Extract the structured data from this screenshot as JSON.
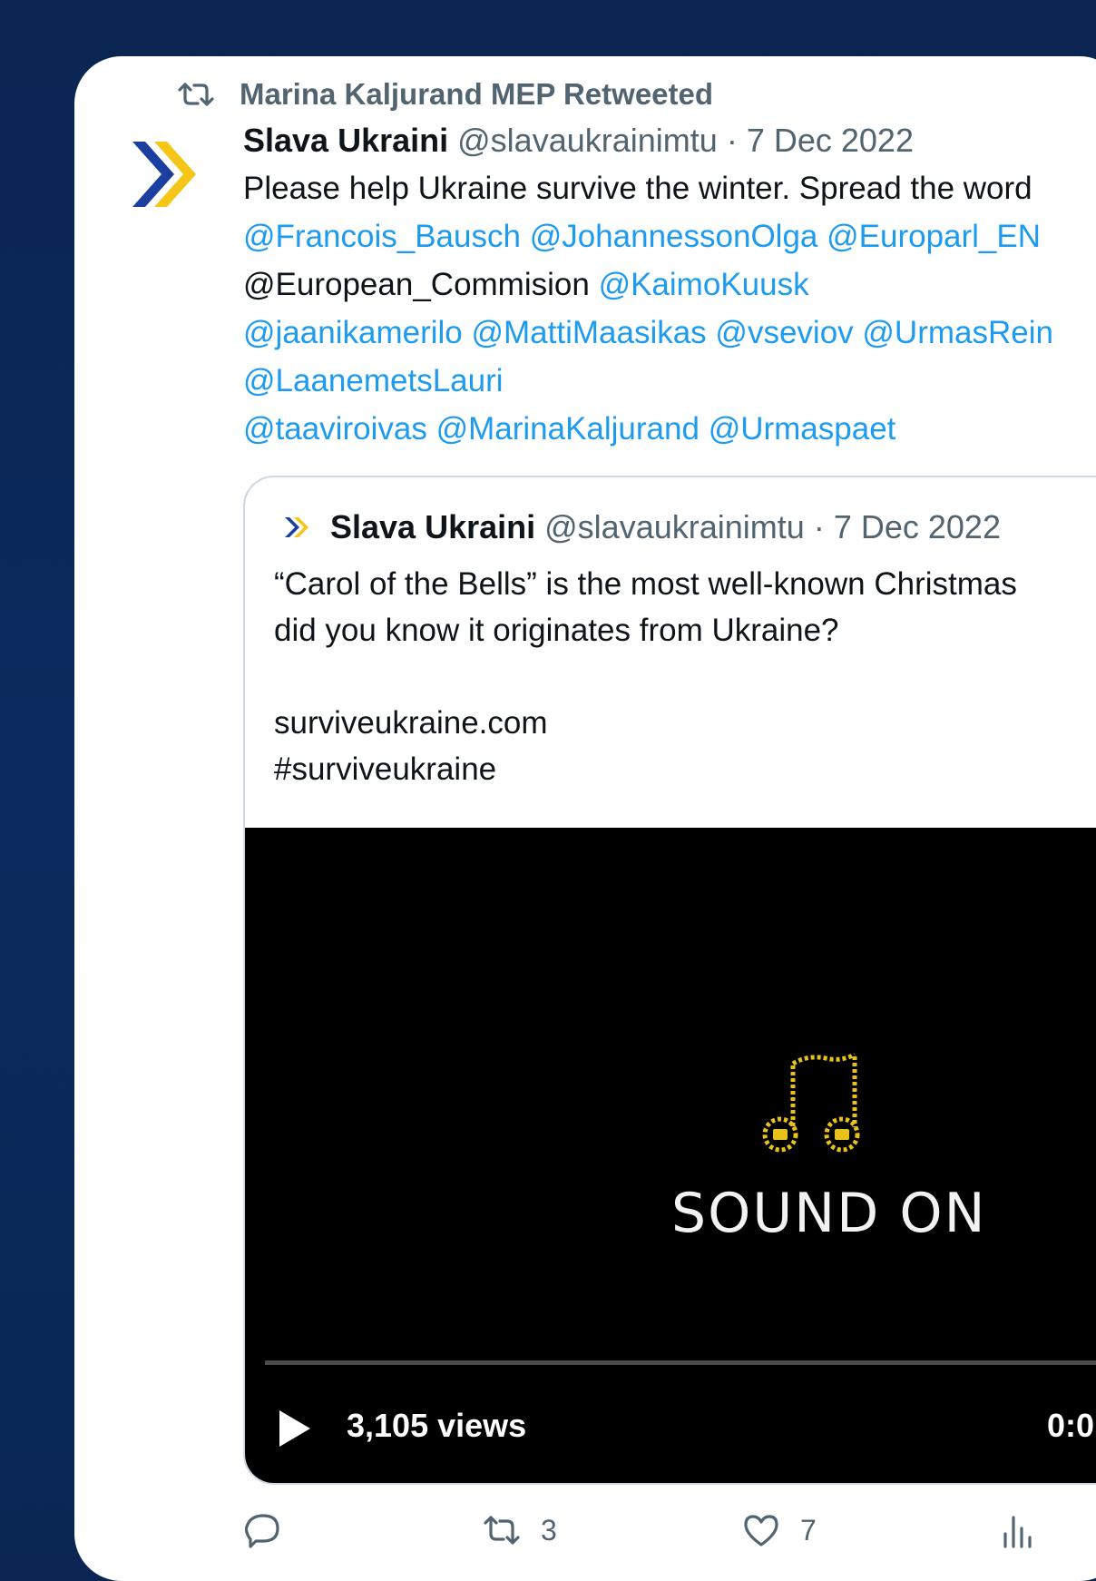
{
  "retweet": {
    "label": "Marina Kaljurand MEP Retweeted",
    "icon": "retweet-icon"
  },
  "tweet": {
    "author_name": "Slava Ukraini",
    "handle": "@slavaukrainimtu",
    "separator": "·",
    "date": "7 Dec 2022",
    "line1": "Please help Ukraine survive the winter. Spread the word",
    "line2": [
      "@Francois_Bausch",
      "@JohannessonOlga",
      "@Europarl_EN"
    ],
    "line3_plain": "@European_Commision",
    "line3_mention": "@KaimoKuusk",
    "line4": [
      "@jaanikamerilo",
      "@MattiMaasikas",
      "@vseviov",
      "@UrmasRein"
    ],
    "line5": [
      "@LaanemetsLauri"
    ],
    "line6": [
      "@taaviroivas",
      "@MarinaKaljurand",
      "@Urmaspaet"
    ]
  },
  "quote": {
    "author_name": "Slava Ukraini",
    "handle": "@slavaukrainimtu",
    "separator": "·",
    "date": "7 Dec 2022",
    "line1": "“Carol of the Bells” is the most well-known Christmas",
    "line2": "did you know it originates from Ukraine?",
    "line3": "surviveukraine.com",
    "line4": "#surviveukraine",
    "video": {
      "overlay_text": "SOUND ON",
      "views": "3,105 views",
      "time": "0:0",
      "icon": "music-note-icon"
    }
  },
  "actions": {
    "reply_count": "",
    "retweet_count": "3",
    "like_count": "7",
    "views_icon": "analytics-icon"
  },
  "colors": {
    "background": "#0b2552",
    "link": "#1d9bf0",
    "muted": "#536471",
    "text": "#0f1419",
    "logo_blue": "#1b3f9e",
    "logo_yellow": "#f5c518"
  }
}
